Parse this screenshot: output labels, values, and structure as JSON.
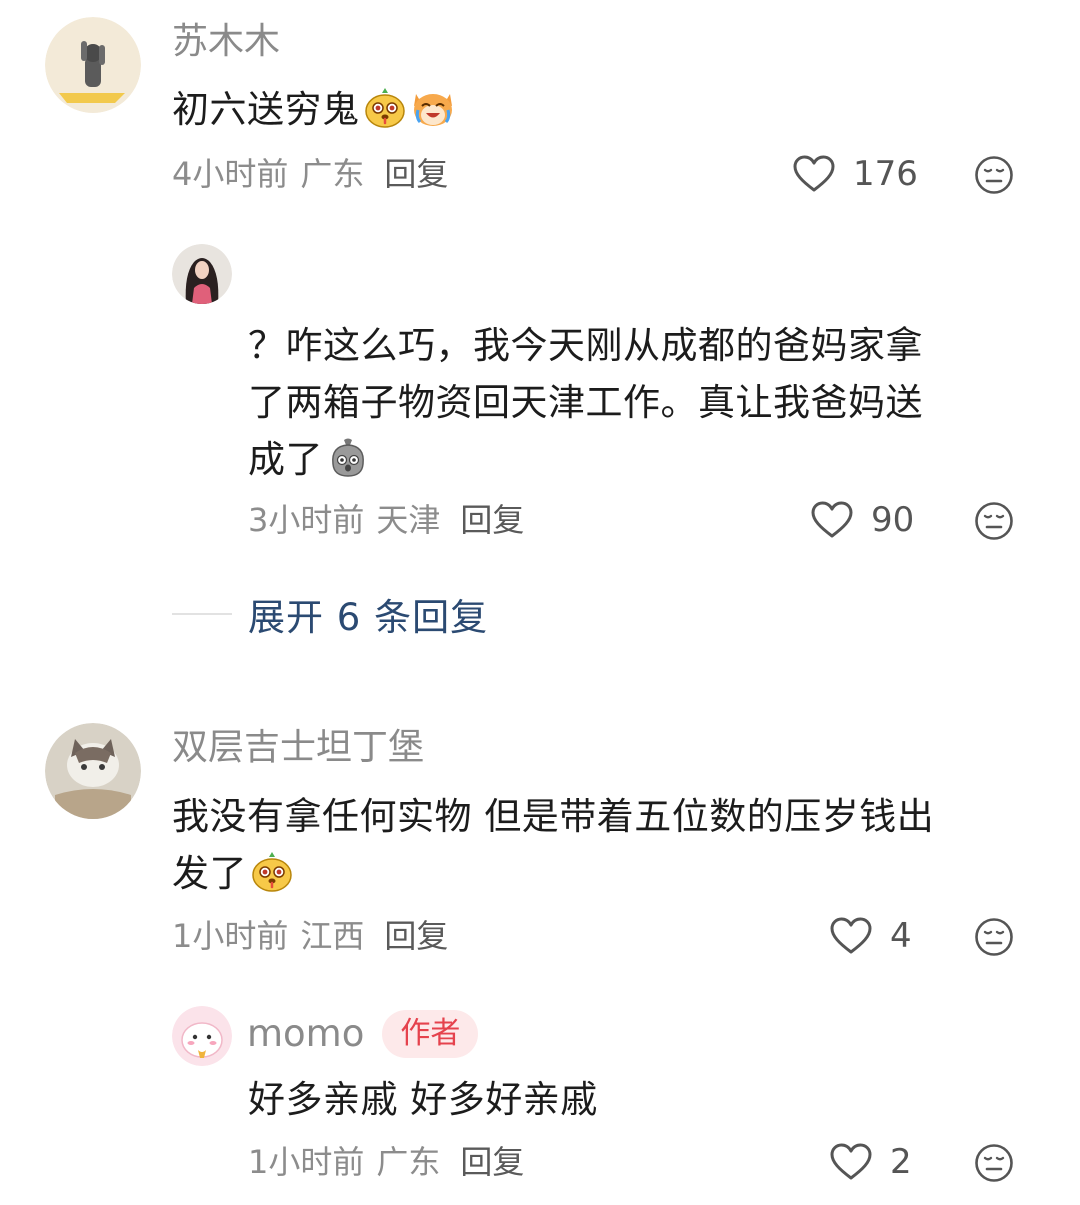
{
  "comments": [
    {
      "username": "苏木木",
      "text_before_emoji": "初六送穷鬼",
      "emojis": [
        "pear-face-emoji",
        "laughing-cat-emoji"
      ],
      "time": "4小时前",
      "location": "广东",
      "reply_label": "回复",
      "likes": "176",
      "reply": {
        "lines": [
          "？咋这么巧，我今天刚从成都的爸妈家拿",
          "了两箱子物资回天津工作。真让我爸妈送",
          "成了"
        ],
        "emoji": "gray-stone-emoji",
        "time": "3小时前",
        "location": "天津",
        "reply_label": "回复",
        "likes": "90"
      },
      "expand_label": "展开 6 条回复"
    },
    {
      "username": "双层吉士坦丁堡",
      "lines": [
        "我没有拿任何实物 但是带着五位数的压岁钱出",
        "发了"
      ],
      "emoji": "pear-face-emoji",
      "time": "1小时前",
      "location": "江西",
      "reply_label": "回复",
      "likes": "4",
      "reply": {
        "username": "momo",
        "badge": "作者",
        "text": "好多亲戚 好多好亲戚",
        "time": "1小时前",
        "location": "广东",
        "reply_label": "回复",
        "likes": "2"
      }
    }
  ]
}
